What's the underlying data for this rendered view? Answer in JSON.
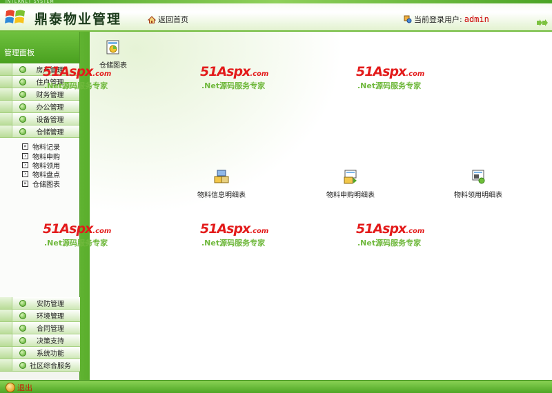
{
  "header": {
    "subtitle": "INTERNET SYSTEM",
    "title": "鼎泰物业管理",
    "home_label": "返回首页",
    "user_prefix": "当前登录用户:",
    "username": "admin"
  },
  "sidebar": {
    "panel_title": "管理面板",
    "top_items": [
      {
        "label": "房产管理"
      },
      {
        "label": "住户管理"
      },
      {
        "label": "财务管理"
      },
      {
        "label": "办公管理"
      },
      {
        "label": "设备管理"
      },
      {
        "label": "仓储管理"
      }
    ],
    "sub_items": [
      {
        "label": "物料记录"
      },
      {
        "label": "物料申购"
      },
      {
        "label": "物料领用"
      },
      {
        "label": "物料盘点"
      },
      {
        "label": "仓储图表"
      }
    ],
    "bottom_items": [
      {
        "label": "安防管理"
      },
      {
        "label": "环境管理"
      },
      {
        "label": "合同管理"
      },
      {
        "label": "决策支持"
      },
      {
        "label": "系统功能"
      },
      {
        "label": "社区综合服务"
      }
    ]
  },
  "main": {
    "tiles": [
      {
        "label": "仓储图表"
      },
      {
        "label": "物料信息明细表"
      },
      {
        "label": "物料申购明细表"
      },
      {
        "label": "物料领用明细表"
      }
    ]
  },
  "watermark": {
    "brand": "51Aspx",
    "domain": ".com",
    "tagline": ".Net源码服务专家"
  },
  "footer": {
    "exit_label": "退出"
  },
  "colors": {
    "accent_green": "#5cb331",
    "username_red": "#cc0000",
    "watermark_red": "#e31b1b"
  }
}
